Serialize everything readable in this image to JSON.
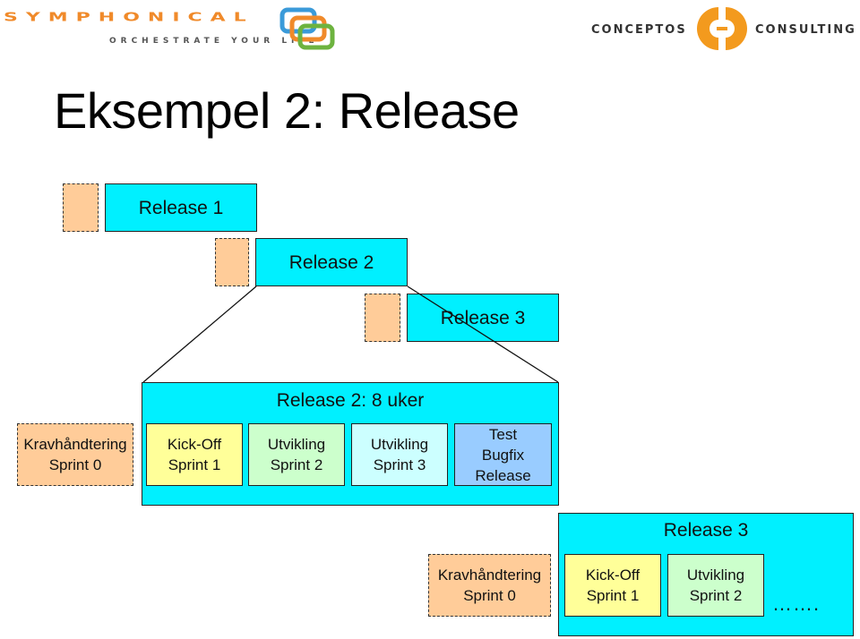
{
  "logos": {
    "left": {
      "name": "SYMPHONICAL",
      "tagline": "ORCHESTRATE YOUR LIFE"
    },
    "right": {
      "left_word": "CONCEPTOS",
      "right_word": "CONSULTING"
    }
  },
  "title": "Eksempel 2: Release",
  "timeline": {
    "releases": [
      {
        "label": "Release 1"
      },
      {
        "label": "Release 2"
      },
      {
        "label": "Release 3"
      }
    ]
  },
  "release2_detail": {
    "label": "Release 2: 8 uker",
    "pre_sprint": "Kravhåndtering\nSprint 0",
    "sprints": [
      {
        "label": "Kick-Off\nSprint 1",
        "color": "#ffff99"
      },
      {
        "label": "Utvikling\nSprint 2",
        "color": "#ccffcc"
      },
      {
        "label": "Utvikling\nSprint 3",
        "color": "#ccffff"
      },
      {
        "label": "Test\nBugfix\nRelease",
        "color": "#99ccff"
      }
    ]
  },
  "release3_detail": {
    "label": "Release 3",
    "pre_sprint": "Kravhåndtering\nSprint 0",
    "sprints": [
      {
        "label": "Kick-Off\nSprint 1",
        "color": "#ffff99"
      },
      {
        "label": "Utvikling\nSprint 2",
        "color": "#ccffcc"
      }
    ],
    "continuation": "……."
  },
  "colors": {
    "release": "#00f0ff",
    "requirements": "#ffcc99",
    "logo_orange": "#f08a2a"
  }
}
